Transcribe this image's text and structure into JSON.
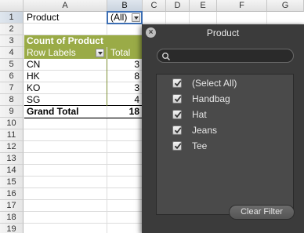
{
  "sheet": {
    "columns": [
      "A",
      "B",
      "C",
      "D",
      "E",
      "F",
      "G"
    ],
    "rows": [
      "1",
      "2",
      "3",
      "4",
      "5",
      "6",
      "7",
      "8",
      "9",
      "10",
      "11",
      "12",
      "13",
      "14",
      "15",
      "16",
      "17",
      "18",
      "19"
    ]
  },
  "cells": {
    "a1": "Product",
    "b1": "(All)",
    "a3": "Count of Product",
    "a4": "Row Labels",
    "b4": "Total",
    "a5": "CN",
    "b5": "3",
    "a6": "HK",
    "b6": "8",
    "a7": "KO",
    "b7": "3",
    "a8": "SG",
    "b8": "4",
    "a9": "Grand Total",
    "b9": "18"
  },
  "filter": {
    "title": "Product",
    "search_placeholder": "",
    "items": [
      {
        "label": "(Select All)",
        "checked": true
      },
      {
        "label": "Handbag",
        "checked": true
      },
      {
        "label": "Hat",
        "checked": true
      },
      {
        "label": "Jeans",
        "checked": true
      },
      {
        "label": "Tee",
        "checked": true
      }
    ],
    "clear_label": "Clear Filter"
  },
  "colors": {
    "pivot_header": "#9aab47",
    "panel_bg": "#3b3b3b",
    "selection": "#3d6fb4"
  }
}
